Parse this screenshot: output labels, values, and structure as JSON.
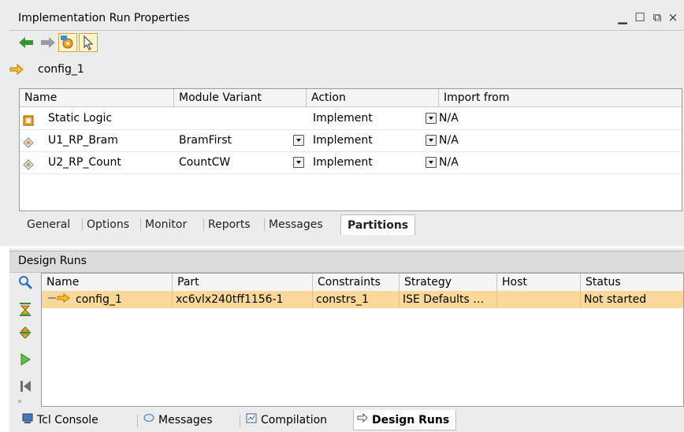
{
  "properties_panel": {
    "title": "Implementation Run Properties",
    "run_name": "config_1",
    "partitions_table": {
      "columns": [
        "Name",
        "Module Variant",
        "Action",
        "Import from"
      ],
      "rows": [
        {
          "name": "Static Logic",
          "variant": "",
          "action": "Implement",
          "import_from": "N/A"
        },
        {
          "name": "U1_RP_Bram",
          "variant": "BramFirst",
          "action": "Implement",
          "import_from": "N/A"
        },
        {
          "name": "U2_RP_Count",
          "variant": "CountCW",
          "action": "Implement",
          "import_from": "N/A"
        }
      ]
    },
    "tabs": [
      "General",
      "Options",
      "Monitor",
      "Reports",
      "Messages",
      "Partitions"
    ],
    "active_tab": "Partitions"
  },
  "design_runs": {
    "title": "Design Runs",
    "columns": [
      "Name",
      "Part",
      "Constraints",
      "Strategy",
      "Host",
      "Status"
    ],
    "rows": [
      {
        "name": "config_1",
        "part": "xc6vlx240tff1156-1",
        "constraints": "constrs_1",
        "strategy": "ISE Defaults …",
        "host": "",
        "status": "Not started"
      }
    ]
  },
  "bottom_tabs": [
    {
      "label": "Tcl Console",
      "icon": "console-icon"
    },
    {
      "label": "Messages",
      "icon": "speech-bubble-icon"
    },
    {
      "label": "Compilation",
      "icon": "compilation-icon"
    },
    {
      "label": "Design Runs",
      "icon": "design-runs-icon"
    }
  ],
  "bottom_active_tab": "Design Runs",
  "colors": {
    "selected_row": "#fcd89a",
    "accent_green": "#2e9a2e",
    "arrow_orange": "#e8a634"
  }
}
